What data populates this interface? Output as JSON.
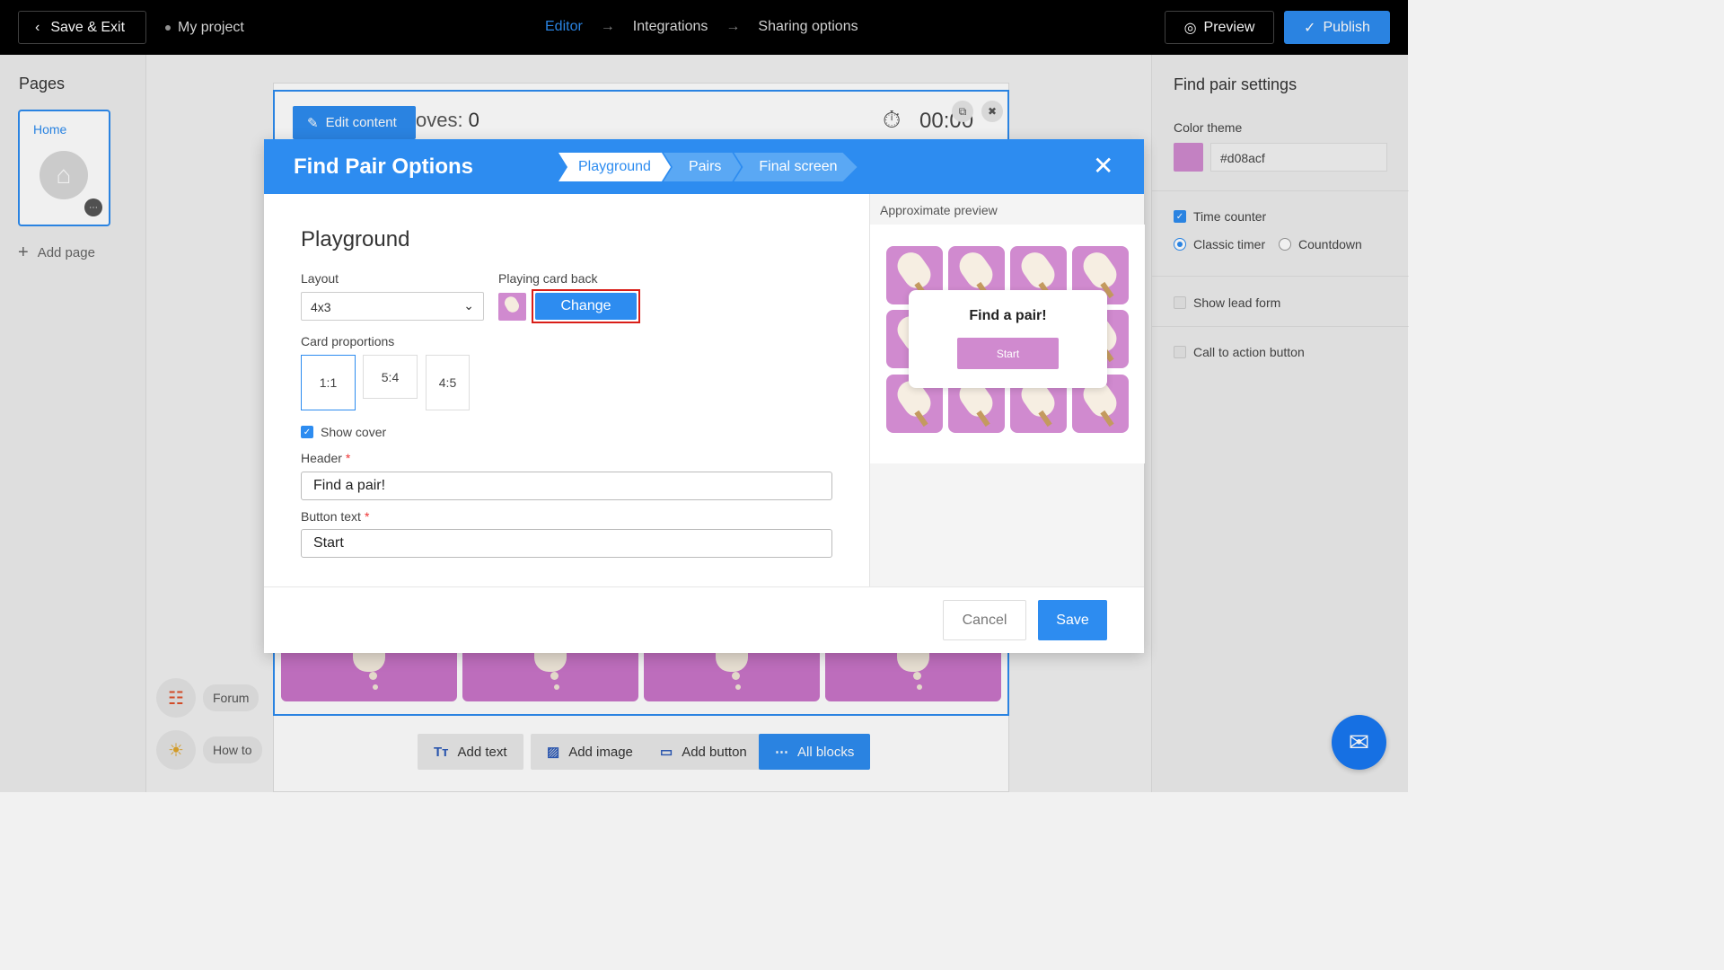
{
  "topbar": {
    "save_exit": "Save & Exit",
    "project_name": "My project",
    "steps": [
      "Editor",
      "Integrations",
      "Sharing options"
    ],
    "preview": "Preview",
    "publish": "Publish"
  },
  "left_panel": {
    "title": "Pages",
    "page_label": "Home",
    "add_page": "Add page",
    "forum": "Forum",
    "howto": "How to"
  },
  "canvas": {
    "edit_content": "Edit content",
    "moves_label": "oves:",
    "moves_value": "0",
    "timer": "00:00",
    "blocks": [
      "Add text",
      "Add image",
      "Add button",
      "All blocks"
    ]
  },
  "right_panel": {
    "title": "Find pair settings",
    "color_theme_label": "Color theme",
    "color_theme_value": "#d08acf",
    "time_counter": "Time counter",
    "classic_timer": "Classic timer",
    "countdown": "Countdown",
    "show_lead_form": "Show lead form",
    "cta_button": "Call to action button"
  },
  "modal": {
    "title": "Find Pair Options",
    "crumbs": [
      "Playground",
      "Pairs",
      "Final screen"
    ],
    "active_crumb": "Playground",
    "section_title": "Playground",
    "layout_label": "Layout",
    "layout_value": "4x3",
    "card_back_label": "Playing card back",
    "change_button": "Change",
    "proportions_label": "Card proportions",
    "proportions": [
      "1:1",
      "5:4",
      "4:5"
    ],
    "selected_proportion": "1:1",
    "show_cover_label": "Show cover",
    "header_label": "Header",
    "header_value": "Find a pair!",
    "button_text_label": "Button text",
    "button_text_value": "Start",
    "preview_label": "Approximate preview",
    "preview_header": "Find a pair!",
    "preview_button": "Start",
    "cancel": "Cancel",
    "save": "Save"
  },
  "colors": {
    "accent": "#2d8cf0",
    "theme": "#d08acf",
    "highlight": "#d91e18"
  }
}
